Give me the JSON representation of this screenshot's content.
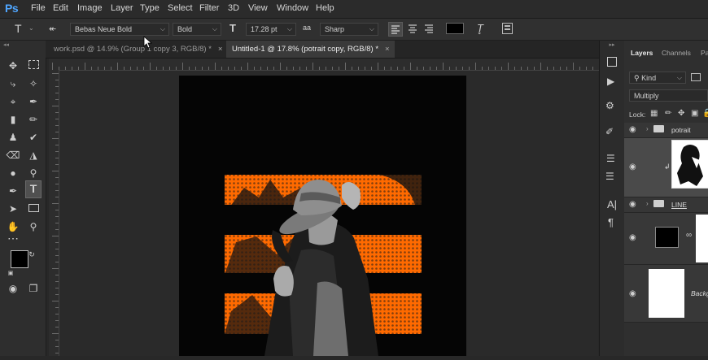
{
  "app": {
    "logo": "Ps",
    "brand_color": "#4fa6ff",
    "accent_orange": "#ff6a00"
  },
  "menu": [
    "File",
    "Edit",
    "Image",
    "Layer",
    "Type",
    "Select",
    "Filter",
    "3D",
    "View",
    "Window",
    "Help"
  ],
  "options": {
    "tool_glyph": "T",
    "font_family": "Bebas Neue Bold",
    "font_style": "Bold",
    "font_size": "17.28 pt",
    "aa_label": "aa",
    "antialias": "Sharp",
    "text_color": "#000000"
  },
  "tabs": [
    {
      "label": "work.psd @ 14.9% (Group 1 copy 3, RGB/8) *",
      "active": false
    },
    {
      "label": "Untitled-1 @ 17.8% (potrait copy, RGB/8) *",
      "active": true
    }
  ],
  "panel": {
    "tabs": [
      "Layers",
      "Channels",
      "Pa"
    ],
    "filter_kind": "Kind",
    "blend_mode": "Multiply",
    "lock_label": "Lock:",
    "layers": [
      {
        "name": "potrait",
        "type": "group"
      },
      {
        "name": "",
        "type": "image"
      },
      {
        "name": "LINE",
        "type": "group"
      },
      {
        "name": "",
        "type": "shape"
      },
      {
        "name": "Backg",
        "type": "background"
      }
    ]
  }
}
